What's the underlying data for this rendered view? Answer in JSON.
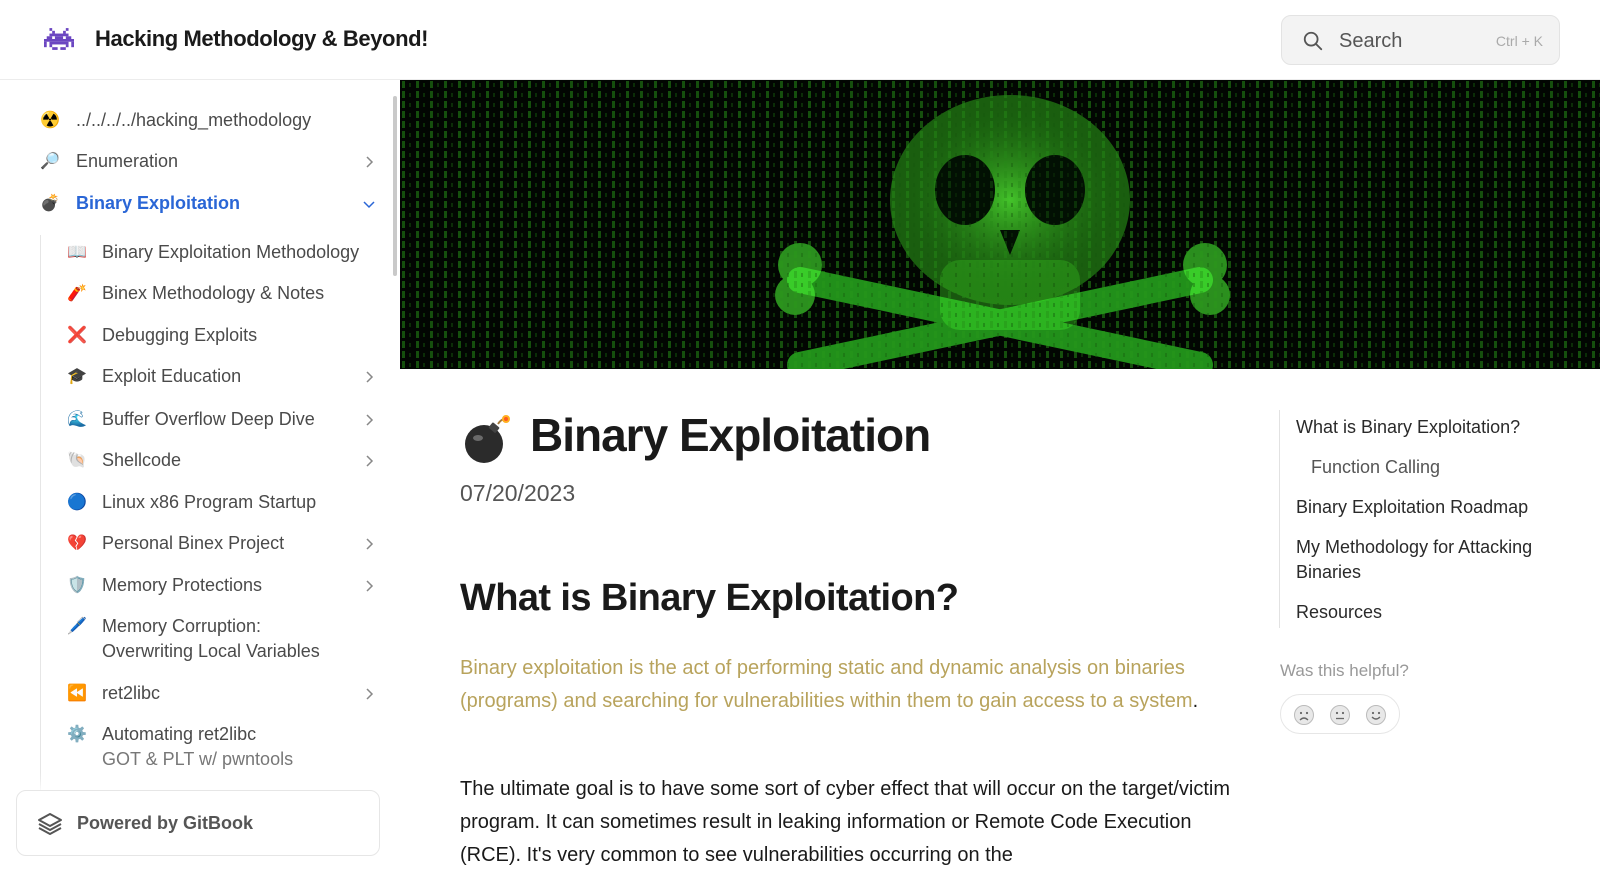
{
  "header": {
    "site_title": "Hacking Methodology & Beyond!",
    "search_placeholder": "Search",
    "search_shortcut": "Ctrl + K"
  },
  "sidebar": {
    "items": [
      {
        "emoji": "☢️",
        "label": "../../../../hacking_methodology",
        "chevron": "none"
      },
      {
        "emoji": "🔎",
        "label": "Enumeration",
        "chevron": "right"
      },
      {
        "emoji": "💣",
        "label": "Binary Exploitation",
        "chevron": "down",
        "active": true
      },
      {
        "emoji": "📖",
        "label": "Binary Exploitation Methodology",
        "chevron": "none"
      },
      {
        "emoji": "🧨",
        "label": "Binex Methodology & Notes",
        "chevron": "none"
      },
      {
        "emoji": "❌",
        "label": "Debugging Exploits",
        "chevron": "none"
      },
      {
        "emoji": "🎓",
        "label": "Exploit Education",
        "chevron": "right"
      },
      {
        "emoji": "🌊",
        "label": "Buffer Overflow Deep Dive",
        "chevron": "right"
      },
      {
        "emoji": "🐚",
        "label": "Shellcode",
        "chevron": "right"
      },
      {
        "emoji": "🔵",
        "label": "Linux x86 Program Startup",
        "chevron": "none"
      },
      {
        "emoji": "💔",
        "label": "Personal Binex Project",
        "chevron": "right"
      },
      {
        "emoji": "🛡️",
        "label": "Memory Protections",
        "chevron": "right"
      },
      {
        "emoji": "🖊️",
        "label": "Memory Corruption:",
        "label2": "Overwriting Local Variables",
        "chevron": "none"
      },
      {
        "emoji": "⏪",
        "label": "ret2libc",
        "chevron": "right"
      },
      {
        "emoji": "⚙️",
        "label": "Automating ret2libc",
        "label2": "GOT & PLT w/ pwntools",
        "chevron": "none"
      }
    ],
    "powered_by": "Powered by GitBook"
  },
  "page": {
    "emoji": "bomb-icon",
    "title": "Binary Exploitation",
    "date": "07/20/2023",
    "section_heading": "What is Binary Exploitation?",
    "intro_link_text": "Binary exploitation is the act of performing static and dynamic analysis on binaries (programs) and searching for vulnerabilities within them to gain access to a system",
    "intro_tail": ".",
    "body_paragraph": "The ultimate goal is to have some sort of cyber effect that will occur on the target/victim program. It can sometimes result in leaking information or Remote Code Execution (RCE). It's very common to see vulnerabilities occurring on the"
  },
  "toc": {
    "items": [
      {
        "label": "What is Binary Exploitation?",
        "level": 1
      },
      {
        "label": "Function Calling",
        "level": 2
      },
      {
        "label": "Binary Exploitation Roadmap",
        "level": 1
      },
      {
        "label": "My Methodology for Attacking Binaries",
        "level": 1
      },
      {
        "label": "Resources",
        "level": 1
      }
    ],
    "helpful_prompt": "Was this helpful?"
  },
  "colors": {
    "accent": "#2a66d6",
    "link": "#b8a35c",
    "hero_green": "#3cff2e"
  }
}
